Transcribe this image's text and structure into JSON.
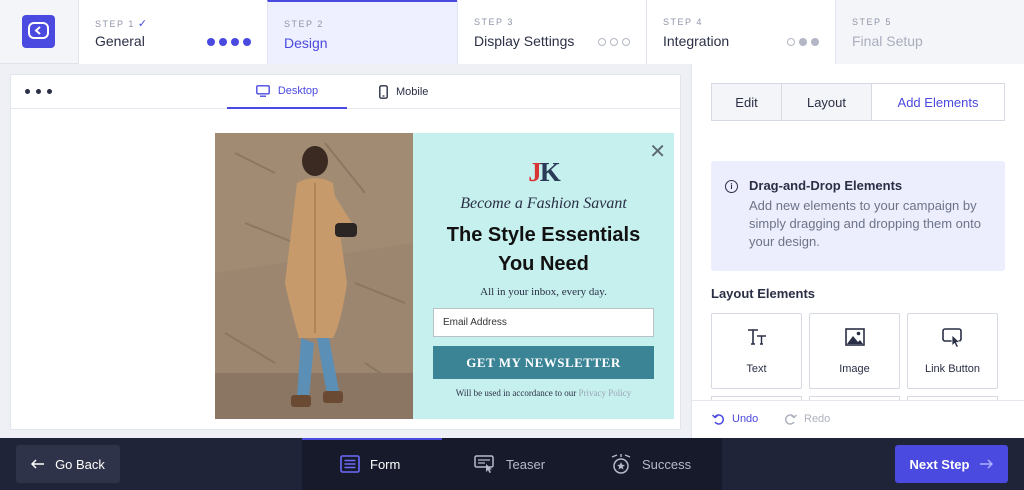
{
  "stepper": {
    "steps": [
      {
        "num": "STEP 1",
        "title": "General",
        "done": "✓"
      },
      {
        "num": "STEP 2",
        "title": "Design"
      },
      {
        "num": "STEP 3",
        "title": "Display Settings"
      },
      {
        "num": "STEP 4",
        "title": "Integration"
      },
      {
        "num": "STEP 5",
        "title": "Final Setup"
      }
    ]
  },
  "preview": {
    "tabs": {
      "desktop": "Desktop",
      "mobile": "Mobile"
    },
    "popup": {
      "brand_j": "J",
      "brand_k": "K",
      "tagline": "Become a Fashion Savant",
      "headline_line1": "The Style Essentials",
      "headline_line2": "You Need",
      "subtext": "All in your inbox, every day.",
      "email_placeholder": "Email Address",
      "cta": "GET MY NEWSLETTER",
      "legal_prefix": "Will be used in accordance to our",
      "legal_link": "Privacy Policy",
      "close_glyph": "✕"
    }
  },
  "editor": {
    "tabs": {
      "edit": "Edit",
      "layout": "Layout",
      "add": "Add Elements"
    },
    "info": {
      "title": "Drag-and-Drop Elements",
      "text": "Add new elements to your campaign by simply dragging and dropping them onto your design.",
      "icon": "i"
    },
    "layout_title": "Layout Elements",
    "elements": [
      {
        "label": "Text",
        "icon": "text-icon"
      },
      {
        "label": "Image",
        "icon": "image-icon"
      },
      {
        "label": "Link Button",
        "icon": "link-button-icon"
      }
    ],
    "undo": "Undo",
    "redo": "Redo"
  },
  "bottom": {
    "go_back": "Go Back",
    "tabs": {
      "form": "Form",
      "teaser": "Teaser",
      "success": "Success"
    },
    "next": "Next Step"
  },
  "colors": {
    "accent": "#4a49e0",
    "popup_bg": "#c6f0ee",
    "cta_bg": "#3b8496",
    "bottom_bar": "#202438"
  }
}
